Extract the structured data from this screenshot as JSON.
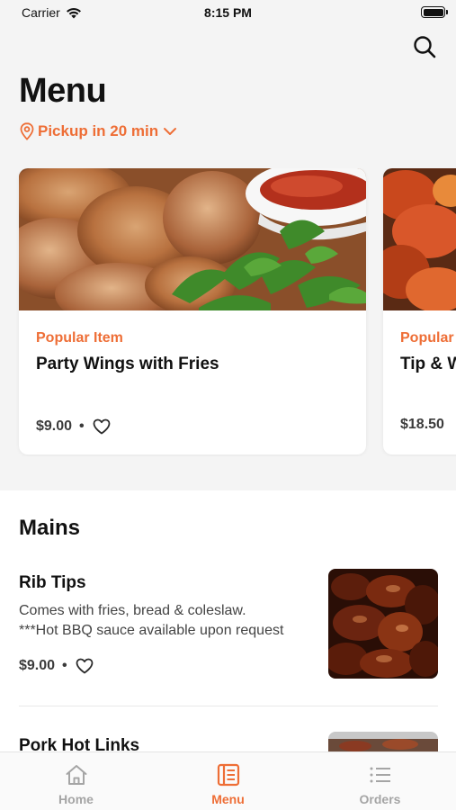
{
  "status_bar": {
    "carrier": "Carrier",
    "time": "8:15 PM"
  },
  "header": {
    "title": "Menu",
    "pickup_label": "Pickup in 20 min"
  },
  "featured": [
    {
      "tag": "Popular Item",
      "title": "Party Wings with Fries",
      "price": "$9.00"
    },
    {
      "tag": "Popular Item",
      "title": "Tip & Wing Combo",
      "price": "$18.50"
    }
  ],
  "mains": {
    "section_title": "Mains",
    "items": [
      {
        "name": "Rib Tips",
        "desc_line1": "Comes with fries, bread & coleslaw.",
        "desc_line2": "***Hot BBQ sauce available upon request",
        "price": "$9.00"
      },
      {
        "name": "Pork Hot Links"
      }
    ]
  },
  "tabs": [
    {
      "label": "Home",
      "icon": "home-icon"
    },
    {
      "label": "Menu",
      "icon": "menu-book-icon",
      "active": true
    },
    {
      "label": "Orders",
      "icon": "list-icon"
    }
  ],
  "colors": {
    "accent": "#ee6e36",
    "inactive": "#a5a5a5"
  }
}
